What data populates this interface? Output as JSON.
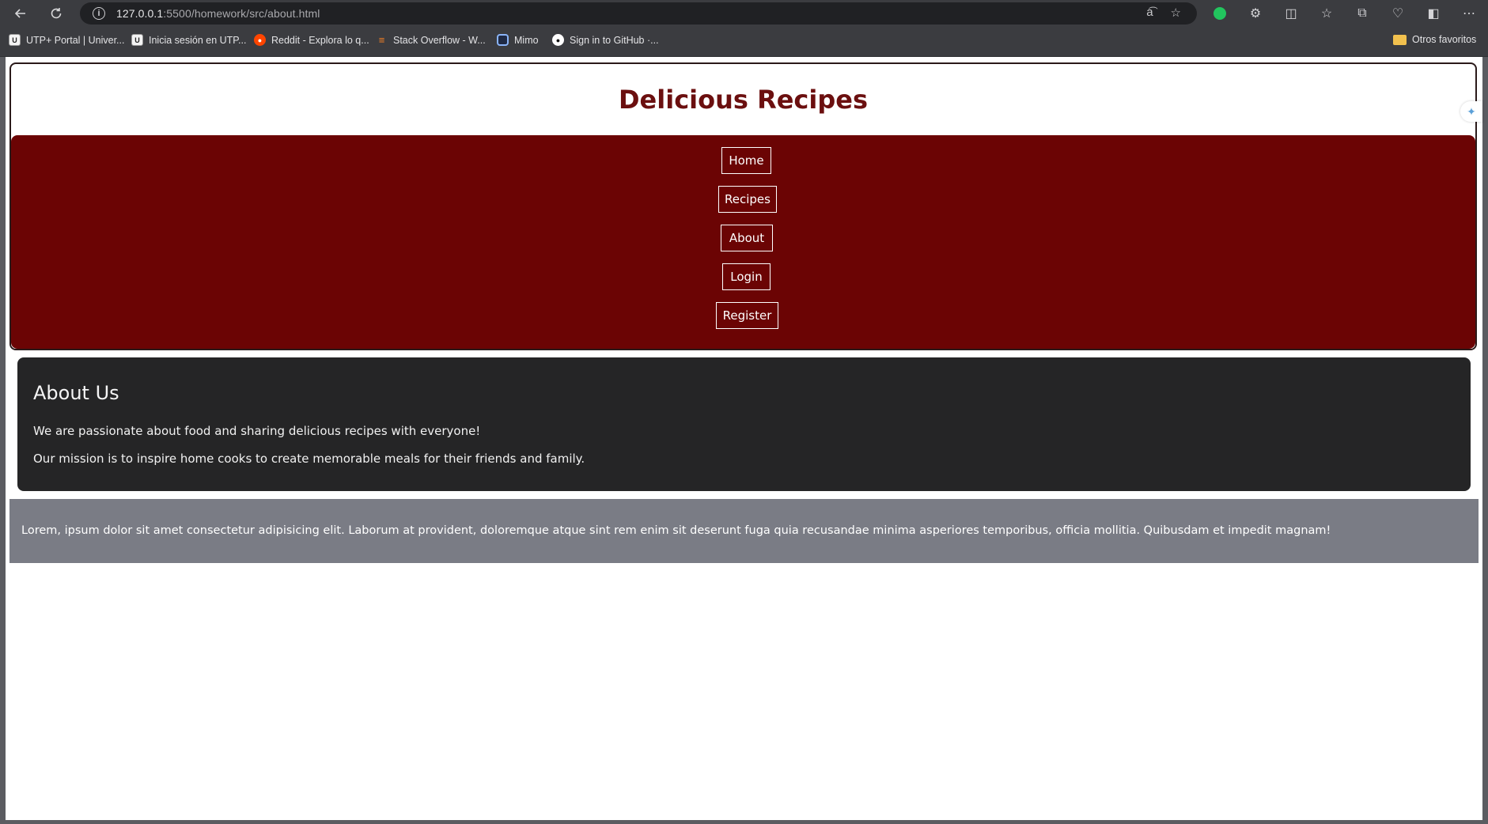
{
  "browser": {
    "url_host": "127.0.0.1",
    "url_path": ":5500/homework/src/about.html",
    "bookmarks": [
      {
        "label": "UTP+ Portal | Univer...",
        "icon": "utp-icon"
      },
      {
        "label": "Inicia sesión en UTP...",
        "icon": "utp-icon"
      },
      {
        "label": "Reddit - Explora lo q...",
        "icon": "reddit-icon"
      },
      {
        "label": "Stack Overflow - W...",
        "icon": "stackoverflow-icon"
      },
      {
        "label": "Mimo",
        "icon": "mimo-icon"
      },
      {
        "label": "Sign in to GitHub ·...",
        "icon": "github-icon"
      }
    ],
    "other_favorites": "Otros favoritos"
  },
  "page": {
    "title": "Delicious Recipes",
    "nav": [
      "Home",
      "Recipes",
      "About",
      "Login",
      "Register"
    ],
    "about": {
      "heading": "About Us",
      "p1": "We are passionate about food and sharing delicious recipes with everyone!",
      "p2": "Our mission is to inspire home cooks to create memorable meals for their friends and family."
    },
    "footer_text": "Lorem, ipsum dolor sit amet consectetur adipisicing elit. Laborum at provident, doloremque atque sint rem enim sit deserunt fuga quia recusandae minima asperiores temporibus, officia mollitia. Quibusdam et impedit magnam!"
  },
  "colors": {
    "title": "#6b0f0f",
    "navbar": "#6b0404",
    "about_bg": "#252526",
    "footer_bg": "#7a7c85"
  }
}
